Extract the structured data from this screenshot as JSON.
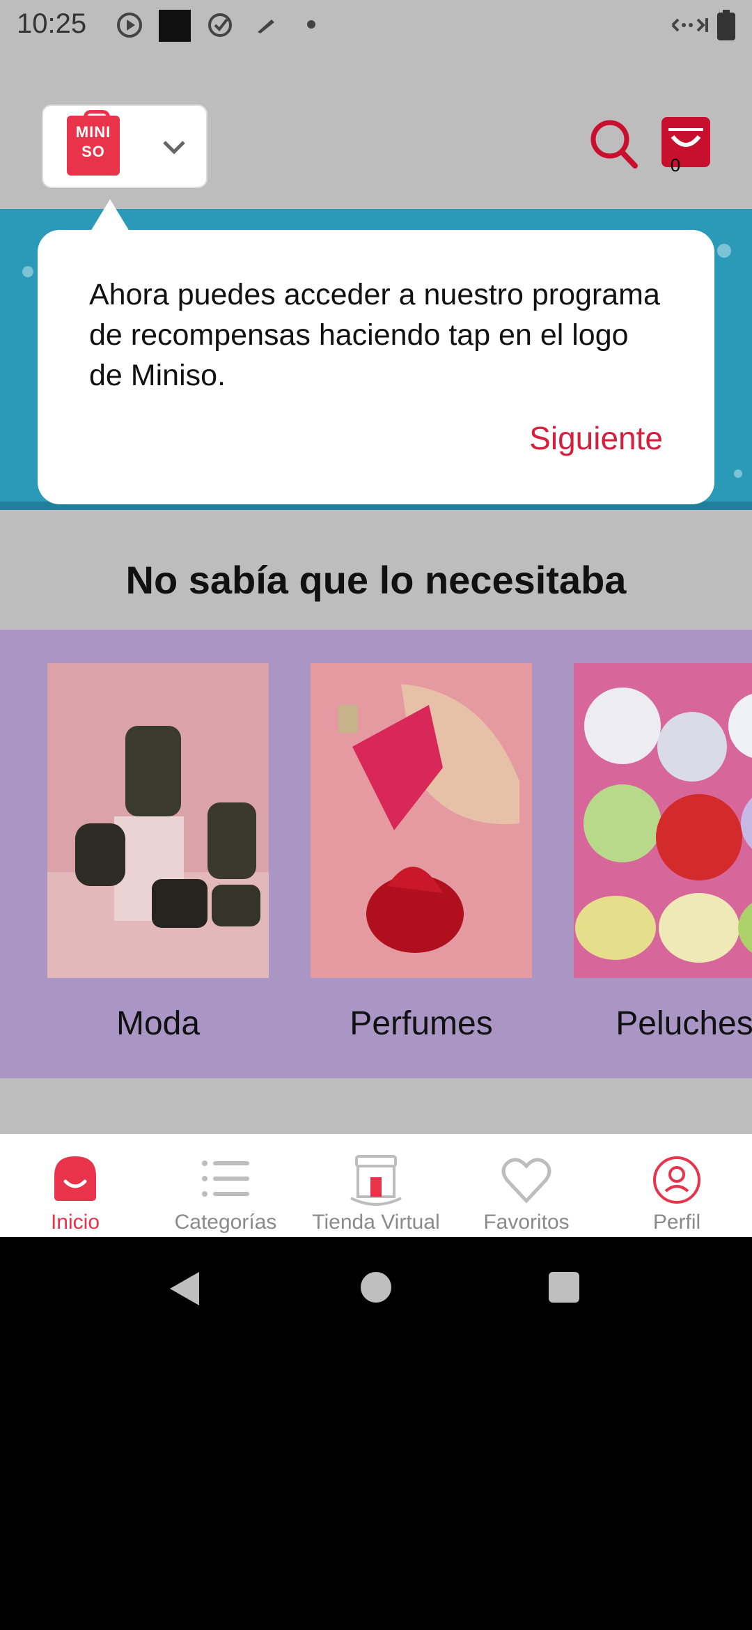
{
  "status_bar": {
    "time": "10:25"
  },
  "header": {
    "cart_count": "0"
  },
  "logo": {
    "line1": "MINI",
    "line2": "SO"
  },
  "tooltip": {
    "message": "Ahora puedes acceder a nuestro programa de recompensas haciendo tap en el logo de Miniso.",
    "next_label": "Siguiente"
  },
  "section": {
    "title": "No sabía que lo necesitaba",
    "cards": [
      {
        "label": "Moda"
      },
      {
        "label": "Perfumes"
      },
      {
        "label": "Peluches"
      }
    ]
  },
  "bottom_nav": {
    "items": [
      {
        "label": "Inicio",
        "icon": "home-icon",
        "active": true
      },
      {
        "label": "Categorías",
        "icon": "categories-icon"
      },
      {
        "label": "Tienda Virtual",
        "icon": "store-icon"
      },
      {
        "label": "Favoritos",
        "icon": "heart-icon"
      },
      {
        "label": "Perfil",
        "icon": "profile-icon"
      }
    ]
  },
  "colors": {
    "brand": "#e8334a",
    "banner": "#2a9ab8",
    "carousel_bg": "#a996c4",
    "overlay_gray": "#bdbdbd"
  }
}
